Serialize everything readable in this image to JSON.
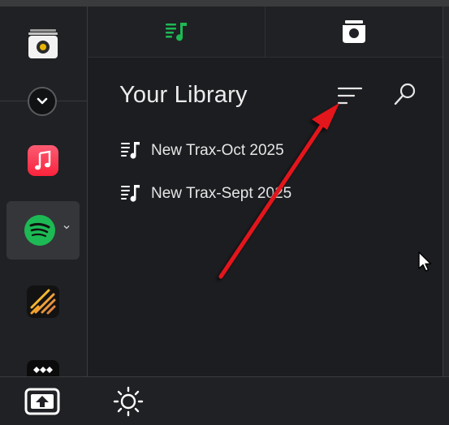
{
  "library": {
    "title": "Your Library",
    "playlists": [
      {
        "label": "New Trax-Oct 2025"
      },
      {
        "label": "New Trax-Sept 2025"
      }
    ]
  },
  "tabs": [
    {
      "icon": "playlist-music-icon",
      "active": true,
      "color": "#1db954"
    },
    {
      "icon": "shopping-bag-icon",
      "active": false
    }
  ],
  "sidebar": {
    "services": [
      {
        "icon": "music-player-app-icon"
      },
      {
        "icon": "collapse-chevron-icon"
      },
      {
        "icon": "apple-music-icon",
        "color": "#fc3c44"
      },
      {
        "icon": "spotify-icon",
        "color": "#1db954",
        "active": true
      },
      {
        "icon": "deezer-icon",
        "color": "#f5a623"
      },
      {
        "icon": "tidal-icon"
      }
    ]
  },
  "bottom": [
    {
      "icon": "upload-window-icon"
    },
    {
      "icon": "brightness-sun-icon"
    }
  ],
  "annotation": {
    "type": "red-arrow",
    "points_to": "sort-button",
    "color": "#e3121b"
  }
}
